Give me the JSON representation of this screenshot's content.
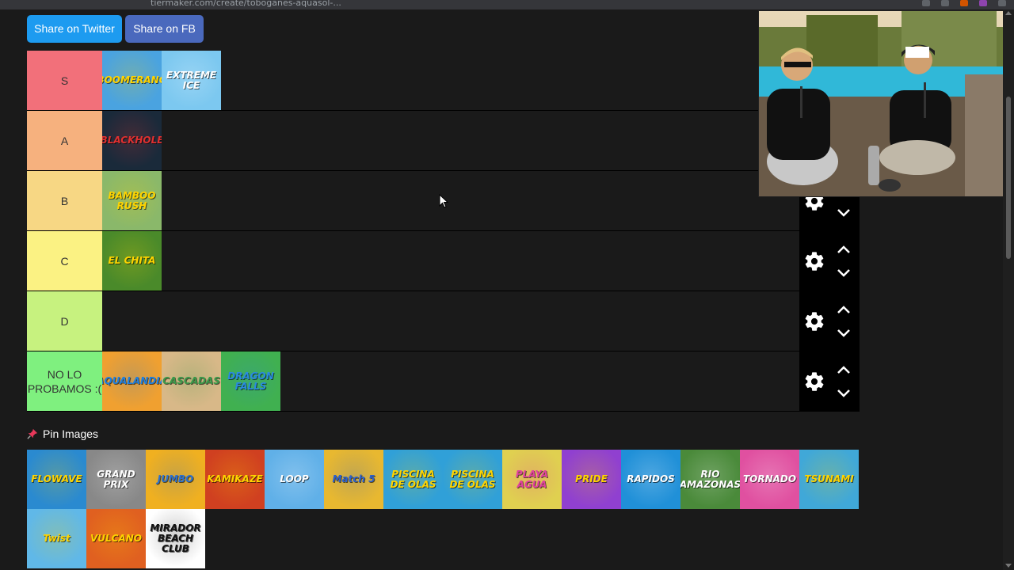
{
  "browser": {
    "url": "tiermaker.com/create/toboganes-aquasol-...",
    "icons": [
      "star-icon",
      "extension-icon",
      "extension-icon",
      "profile-icon",
      "menu-icon"
    ]
  },
  "share": {
    "twitter_label": "Share on Twitter",
    "fb_label": "Share on FB"
  },
  "tiers": [
    {
      "label": "S",
      "color": "#f2707a",
      "items": [
        {
          "name": "boomerang",
          "text": "BOOMERANG",
          "bg": "#4aa3e0",
          "fg": "#ffd400"
        },
        {
          "name": "extreme-ice",
          "text": "EXTREME ICE",
          "bg": "#7cc8f0",
          "fg": "#ffffff"
        }
      ]
    },
    {
      "label": "A",
      "color": "#f6b17e",
      "items": [
        {
          "name": "blackhole",
          "text": "BLACKHOLE",
          "bg": "#1a2a3a",
          "fg": "#e03030"
        }
      ]
    },
    {
      "label": "B",
      "color": "#f7d784",
      "items": [
        {
          "name": "bamboo-rush",
          "text": "BAMBOO RUSH",
          "bg": "#8ab86a",
          "fg": "#ffd400"
        }
      ]
    },
    {
      "label": "C",
      "color": "#fbf283",
      "items": [
        {
          "name": "el-chita",
          "text": "EL CHITA",
          "bg": "#4a8a2a",
          "fg": "#ffd400"
        }
      ]
    },
    {
      "label": "D",
      "color": "#c7f27f",
      "items": []
    },
    {
      "label": "NO LO PROBAMOS :(",
      "color": "#7ff07f",
      "items": [
        {
          "name": "aqualandia",
          "text": "AQUALANDIA",
          "bg": "#f0a030",
          "fg": "#2080e0"
        },
        {
          "name": "cascadas",
          "text": "CASCADAS",
          "bg": "#d8b888",
          "fg": "#3a9a4a"
        },
        {
          "name": "dragon-falls",
          "text": "DRAGON FALLS",
          "bg": "#40b050",
          "fg": "#2a8ae0"
        }
      ]
    }
  ],
  "pin_header": "Pin Images",
  "pinned": [
    {
      "name": "flowave",
      "text": "FLOWAVE",
      "bg": "#2a8ad0",
      "fg": "#ffd400"
    },
    {
      "name": "grand-prix",
      "text": "GRAND PRIX",
      "bg": "#888888",
      "fg": "#ffffff"
    },
    {
      "name": "jumbo",
      "text": "JUMBO",
      "bg": "#f0b020",
      "fg": "#2a70d0"
    },
    {
      "name": "kamikaze",
      "text": "KAMIKAZE",
      "bg": "#d04020",
      "fg": "#ffd400"
    },
    {
      "name": "loop",
      "text": "LOOP",
      "bg": "#60b0e8",
      "fg": "#ffffff"
    },
    {
      "name": "match-5",
      "text": "Match 5",
      "bg": "#e8b830",
      "fg": "#2a60d0"
    },
    {
      "name": "piscina-de-olas-1",
      "text": "PISCINA DE OLAS",
      "bg": "#30a0d8",
      "fg": "#ffd400"
    },
    {
      "name": "piscina-de-olas-2",
      "text": "PISCINA DE OLAS",
      "bg": "#30a0d8",
      "fg": "#ffd400"
    },
    {
      "name": "playa-agua",
      "text": "PLAYA AGUA",
      "bg": "#e0d050",
      "fg": "#e040a0"
    },
    {
      "name": "pride",
      "text": "PRIDE",
      "bg": "#9040d0",
      "fg": "#ffd400"
    },
    {
      "name": "rapidos",
      "text": "RAPIDOS",
      "bg": "#2090d8",
      "fg": "#ffffff"
    },
    {
      "name": "rio-amazonas",
      "text": "RIO AMAZONAS",
      "bg": "#4a8a3a",
      "fg": "#ffffff"
    },
    {
      "name": "tornado",
      "text": "TORNADO",
      "bg": "#e050a0",
      "fg": "#ffffff"
    },
    {
      "name": "tsunami",
      "text": "TSUNAMI",
      "bg": "#40a8d8",
      "fg": "#ffd400"
    },
    {
      "name": "twist",
      "text": "Twist",
      "bg": "#60b8e8",
      "fg": "#ffd400"
    },
    {
      "name": "vulcano",
      "text": "VULCANO",
      "bg": "#e06020",
      "fg": "#ffd400"
    },
    {
      "name": "mirador",
      "text": "MIRADOR BEACH CLUB",
      "bg": "#ffffff",
      "fg": "#111111"
    }
  ]
}
